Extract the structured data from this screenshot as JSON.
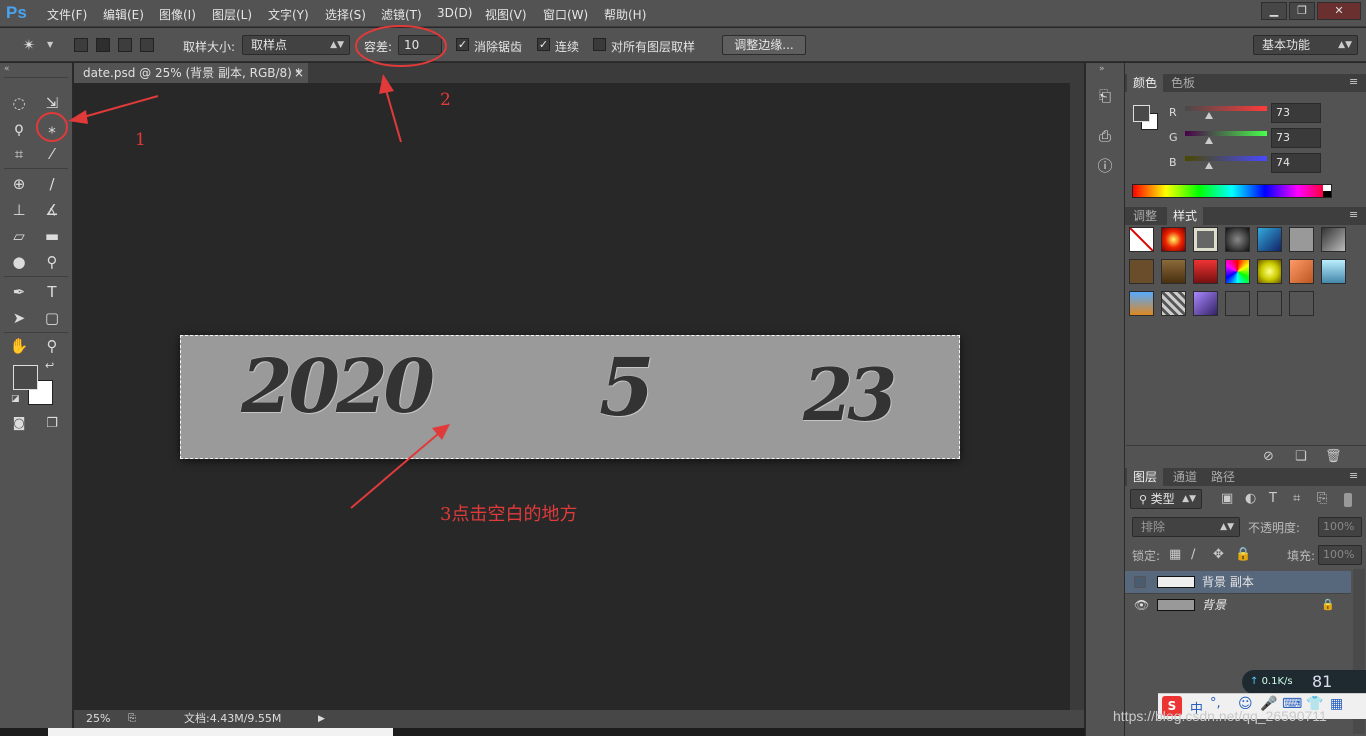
{
  "app": {
    "logo": "Ps"
  },
  "menu": [
    "文件(F)",
    "编辑(E)",
    "图像(I)",
    "图层(L)",
    "文字(Y)",
    "选择(S)",
    "滤镜(T)",
    "3D(D)",
    "视图(V)",
    "窗口(W)",
    "帮助(H)"
  ],
  "window_controls": {
    "minimize": "▁",
    "restore": "❐",
    "close": "✕"
  },
  "options": {
    "sample_size_label": "取样大小:",
    "sample_size_value": "取样点",
    "tolerance_label": "容差:",
    "tolerance_value": "10",
    "antialias_label": "消除锯齿",
    "antialias_checked": true,
    "contiguous_label": "连续",
    "contiguous_checked": true,
    "sample_all_layers_label": "对所有图层取样",
    "sample_all_layers_checked": false,
    "refine_edge_button": "调整边缘...",
    "workspace_value": "基本功能"
  },
  "document": {
    "tab_title": "date.psd @ 25% (背景 副本, RGB/8) *",
    "tab_close": "×",
    "handwriting": {
      "year": "2020",
      "month": "5",
      "day": "23"
    }
  },
  "annotations": {
    "label1": "1",
    "label2": "2",
    "label3": "3点击空白的地方",
    "color": "#e03a3a"
  },
  "status": {
    "zoom": "25%",
    "doc_size": "文档:4.43M/9.55M"
  },
  "color_panel": {
    "tabs": [
      "颜色",
      "色板"
    ],
    "channels": [
      {
        "name": "R",
        "value": "73"
      },
      {
        "name": "G",
        "value": "73"
      },
      {
        "name": "B",
        "value": "74"
      }
    ]
  },
  "styles_panel": {
    "tabs": [
      "调整",
      "样式"
    ]
  },
  "layers_panel": {
    "tabs": [
      "图层",
      "通道",
      "路径"
    ],
    "filter_kind": "类型",
    "blend_mode": "排除",
    "opacity_label": "不透明度:",
    "opacity_value": "100%",
    "lock_label": "锁定:",
    "fill_label": "填充:",
    "fill_value": "100%",
    "layers": [
      {
        "name": "背景 副本",
        "visible": false,
        "selected": true
      },
      {
        "name": "背景",
        "visible": true,
        "locked": true
      }
    ]
  },
  "overlay": {
    "net_speed": "0.1K/s",
    "net_percent": "81",
    "ime_label": "中",
    "watermark": "https://blog.csdn.net/qq_26590711"
  }
}
